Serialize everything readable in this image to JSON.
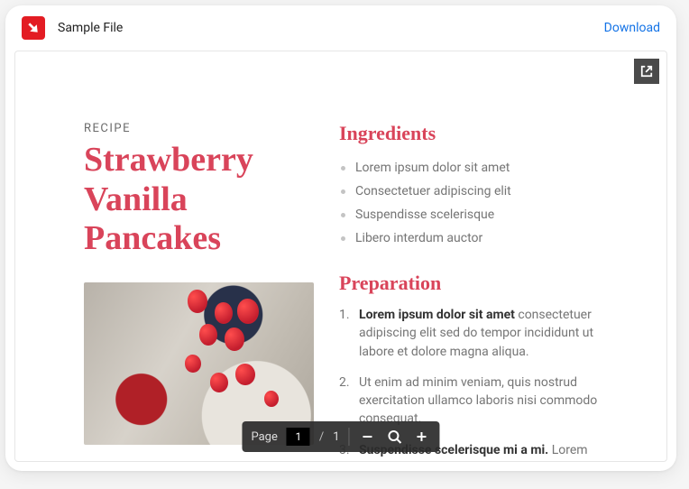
{
  "topbar": {
    "file_title": "Sample File",
    "download_label": "Download"
  },
  "document": {
    "eyebrow": "RECIPE",
    "title": "Strawberry Vanilla Pancakes",
    "ingredients_heading": "Ingredients",
    "ingredients": [
      "Lorem ipsum dolor sit amet",
      "Consectetuer adipiscing elit",
      "Suspendisse scelerisque",
      "Libero interdum auctor"
    ],
    "preparation_heading": "Preparation",
    "preparation": [
      {
        "lead": "Lorem ipsum dolor sit amet",
        "rest": " consectetuer adipiscing elit sed do tempor incididunt ut labore et dolore magna aliqua."
      },
      {
        "lead": "",
        "rest": "Ut enim ad minim veniam, quis nostrud exercitation ullamco laboris nisi commodo consequat."
      },
      {
        "lead": "Suspendisse scelerisque mi a mi.",
        "rest": " Lorem ipsum dolor sit amet, consectetuer"
      }
    ]
  },
  "toolbar": {
    "page_label": "Page",
    "current_page": "1",
    "page_separator": "/",
    "total_pages": "1"
  }
}
